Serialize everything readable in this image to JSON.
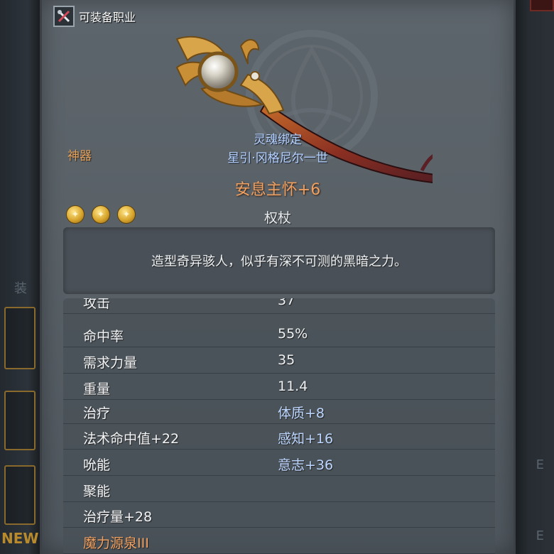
{
  "equip_class": {
    "label": "可装备职业",
    "icon": "crossed-tools-icon"
  },
  "item": {
    "rarity": "神器",
    "binding": "灵魂绑定",
    "crafter": "星引·冈格尼尔一世",
    "name": "安息主怀+6",
    "type": "权杖",
    "stars": 3,
    "description": "造型奇异骇人，似乎有深不可测的黑暗之力。"
  },
  "stats": [
    {
      "label": "攻击",
      "value": "37",
      "value_style": "plain"
    },
    {
      "label": "命中率",
      "value": "55%",
      "value_style": "plain"
    },
    {
      "label": "需求力量",
      "value": "35",
      "value_style": "plain"
    },
    {
      "label": "重量",
      "value": "11.4",
      "value_style": "plain"
    },
    {
      "label": "治疗",
      "value": "体质+8",
      "value_style": "blue"
    },
    {
      "label": "法术命中值+22",
      "value": "感知+16",
      "value_style": "blue"
    },
    {
      "label": "吮能",
      "value": "意志+36",
      "value_style": "blue"
    },
    {
      "label": "聚能",
      "value": "",
      "value_style": "plain"
    },
    {
      "label": "治疗量+28",
      "value": "",
      "value_style": "plain"
    },
    {
      "label": "魔力源泉III",
      "value": "",
      "value_style": "orange"
    }
  ],
  "background": {
    "new_badge": "NEW",
    "ghost_left": "装",
    "ghost_right_1": "E",
    "ghost_right_2": "E"
  },
  "colors": {
    "rarity": "#e3a05a",
    "soulbound": "#b5d2ff",
    "item_name": "#f0a060",
    "bonus_blue": "#bcd6ff"
  }
}
